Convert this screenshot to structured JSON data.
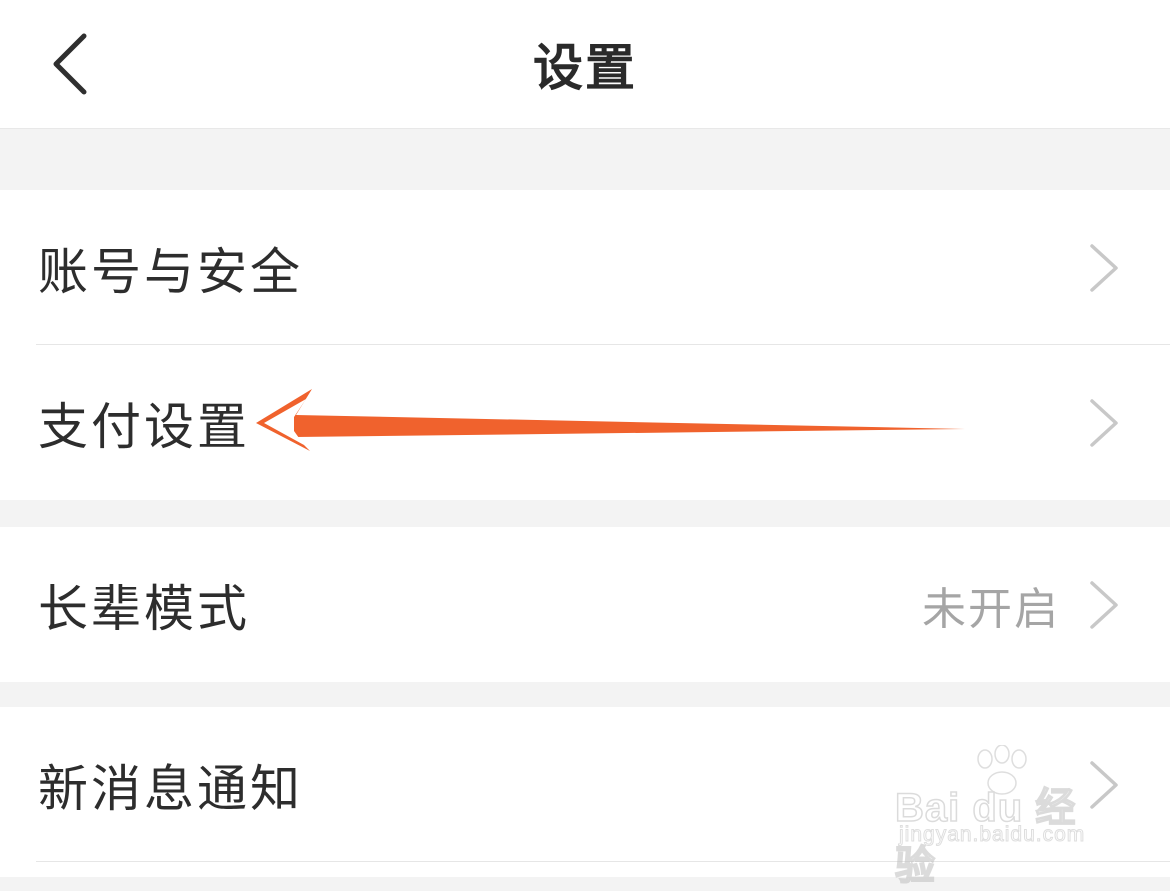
{
  "header": {
    "title": "设置",
    "back_icon": "chevron-left-icon"
  },
  "groups": [
    {
      "items": [
        {
          "label": "账号与安全",
          "value": "",
          "icon": "chevron-right-icon"
        },
        {
          "label": "支付设置",
          "value": "",
          "icon": "chevron-right-icon"
        }
      ]
    },
    {
      "items": [
        {
          "label": "长辈模式",
          "value": "未开启",
          "icon": "chevron-right-icon"
        }
      ]
    },
    {
      "items": [
        {
          "label": "新消息通知",
          "value": "",
          "icon": "chevron-right-icon"
        }
      ]
    }
  ],
  "annotation": {
    "type": "arrow",
    "color": "#f0622d",
    "points_to": "支付设置"
  },
  "watermark": {
    "brand": "Bai du 经验",
    "url": "jingyan.baidu.com"
  },
  "colors": {
    "background": "#f3f3f3",
    "surface": "#ffffff",
    "text_primary": "#2d2d2d",
    "text_secondary": "#a5a5a5",
    "chevron": "#c8c8c8",
    "annotation_arrow": "#f0622d"
  }
}
